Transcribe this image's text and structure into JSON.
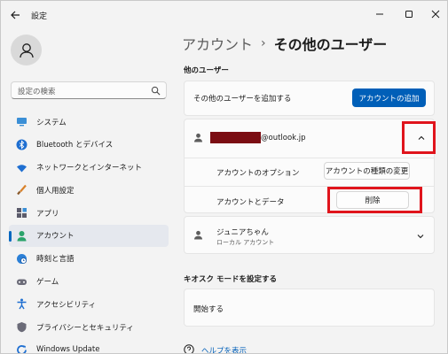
{
  "window": {
    "title": "設定"
  },
  "sidebar": {
    "search_placeholder": "設定の検索",
    "items": [
      {
        "label": "システム",
        "icon": "monitor-icon",
        "active": false
      },
      {
        "label": "Bluetooth とデバイス",
        "icon": "bluetooth-icon",
        "active": false
      },
      {
        "label": "ネットワークとインターネット",
        "icon": "wifi-icon",
        "active": false
      },
      {
        "label": "個人用設定",
        "icon": "brush-icon",
        "active": false
      },
      {
        "label": "アプリ",
        "icon": "apps-icon",
        "active": false
      },
      {
        "label": "アカウント",
        "icon": "person-icon",
        "active": true
      },
      {
        "label": "時刻と言語",
        "icon": "globe-clock-icon",
        "active": false
      },
      {
        "label": "ゲーム",
        "icon": "gamepad-icon",
        "active": false
      },
      {
        "label": "アクセシビリティ",
        "icon": "accessibility-icon",
        "active": false
      },
      {
        "label": "プライバシーとセキュリティ",
        "icon": "shield-icon",
        "active": false
      },
      {
        "label": "Windows Update",
        "icon": "refresh-icon",
        "active": false
      }
    ]
  },
  "breadcrumb": {
    "parent": "アカウント",
    "separator": "›",
    "current": "その他のユーザー"
  },
  "other_users": {
    "section_title": "他のユーザー",
    "add_label": "その他のユーザーを追加する",
    "add_button": "アカウントの追加",
    "expanded_user": {
      "email_suffix": "@outlook.jp",
      "options_label": "アカウントのオプション",
      "change_type_button": "アカウントの種類の変更",
      "data_label": "アカウントとデータ",
      "delete_button": "削除"
    },
    "second_user": {
      "name": "ジュニアちゃん",
      "type": "ローカル アカウント"
    }
  },
  "kiosk": {
    "section_title": "キオスク モードを設定する",
    "start_label": "開始する"
  },
  "help": {
    "label": "ヘルプを表示"
  },
  "colors": {
    "accent": "#005fb8",
    "highlight": "#e0141c",
    "redaction": "#7b0d13"
  }
}
